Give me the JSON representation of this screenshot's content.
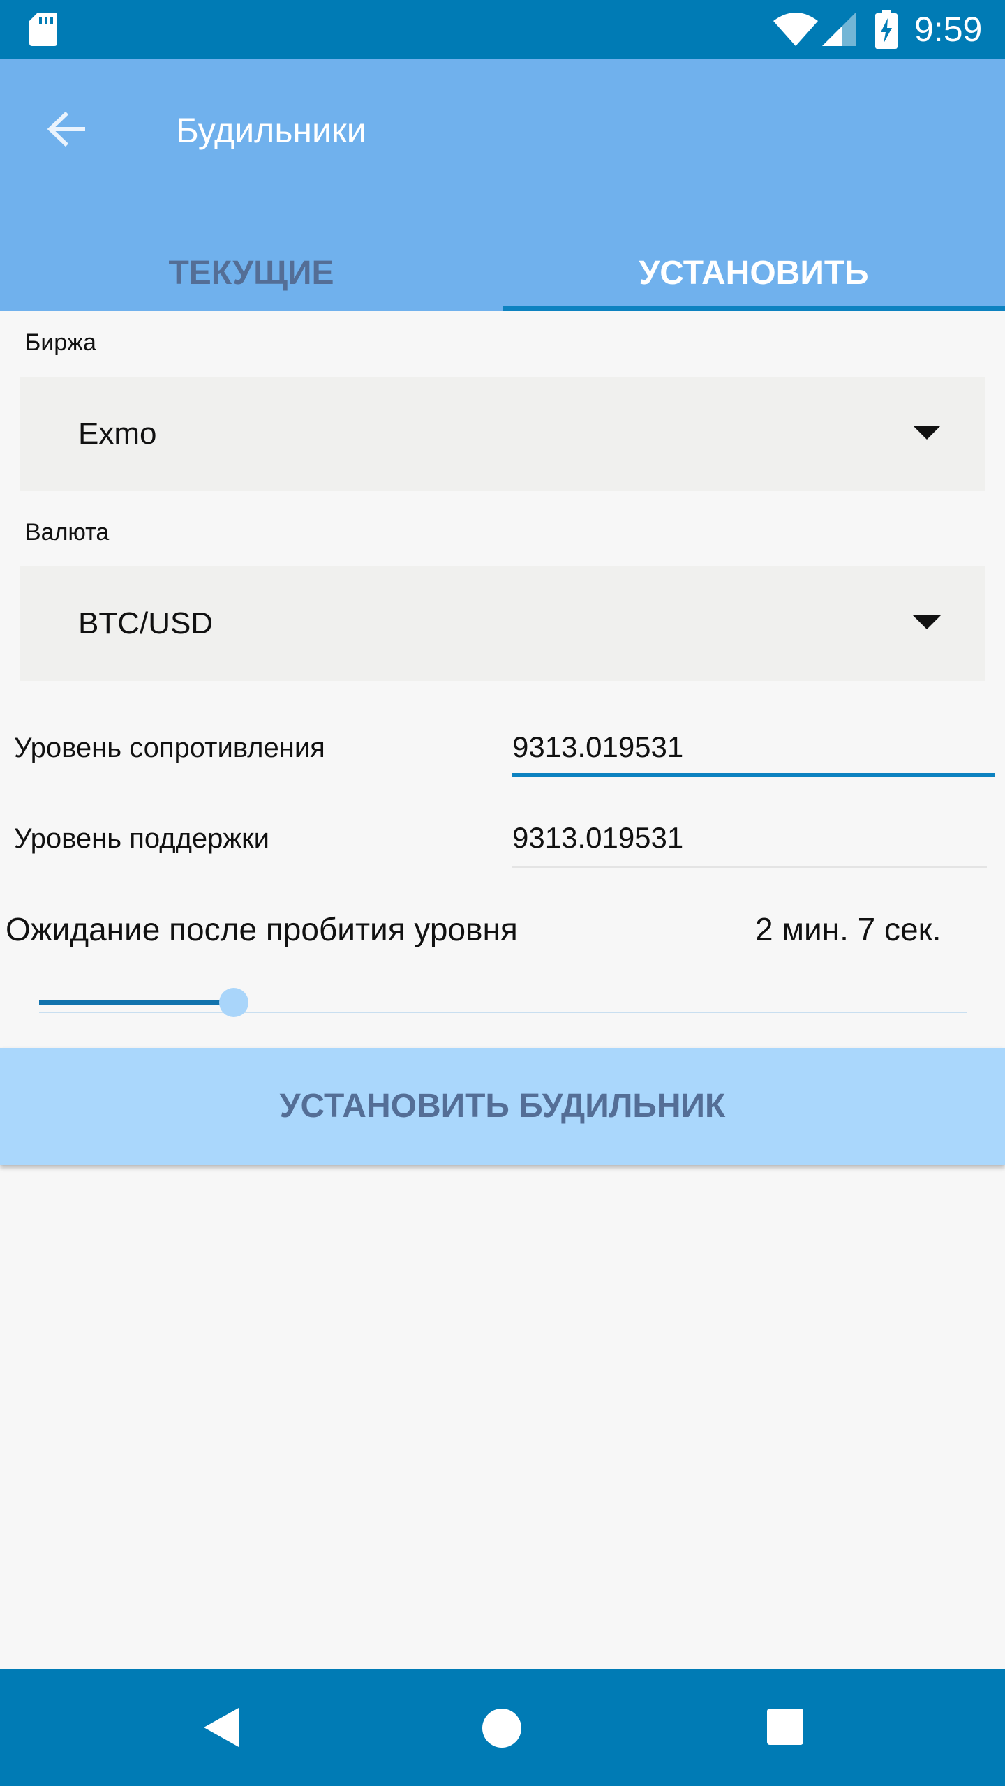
{
  "status_bar": {
    "time": "9:59",
    "icons": [
      "sd-card-icon",
      "wifi-icon",
      "signal-icon",
      "battery-charging-icon"
    ]
  },
  "app_bar": {
    "title": "Будильники",
    "back_icon": "arrow-left-icon"
  },
  "tabs": [
    {
      "label": "ТЕКУЩИЕ",
      "selected": false
    },
    {
      "label": "УСТАНОВИТЬ",
      "selected": true
    }
  ],
  "form": {
    "exchange_label": "Биржа",
    "exchange_value": "Exmo",
    "currency_label": "Валюта",
    "currency_value": "BTC/USD",
    "resistance_label": "Уровень сопротивления",
    "resistance_value": "9313.019531",
    "support_label": "Уровень поддержки",
    "support_value": "9313.019531",
    "wait_label": "Ожидание после пробития уровня",
    "wait_value": "2 мин. 7 сек.",
    "wait_slider_fraction": 0.21
  },
  "set_button_label": "УСТАНОВИТЬ БУДИЛЬНИК",
  "colors": {
    "status_bar": "#007bb5",
    "app_bar": "#70b1ed",
    "accent": "#0d82c0",
    "tab_inactive": "#546e96",
    "button_bg": "#aad7fc",
    "nav_bar": "#007bb5"
  },
  "nav_bar": {
    "icons": [
      "nav-back-icon",
      "nav-home-icon",
      "nav-recents-icon"
    ]
  }
}
